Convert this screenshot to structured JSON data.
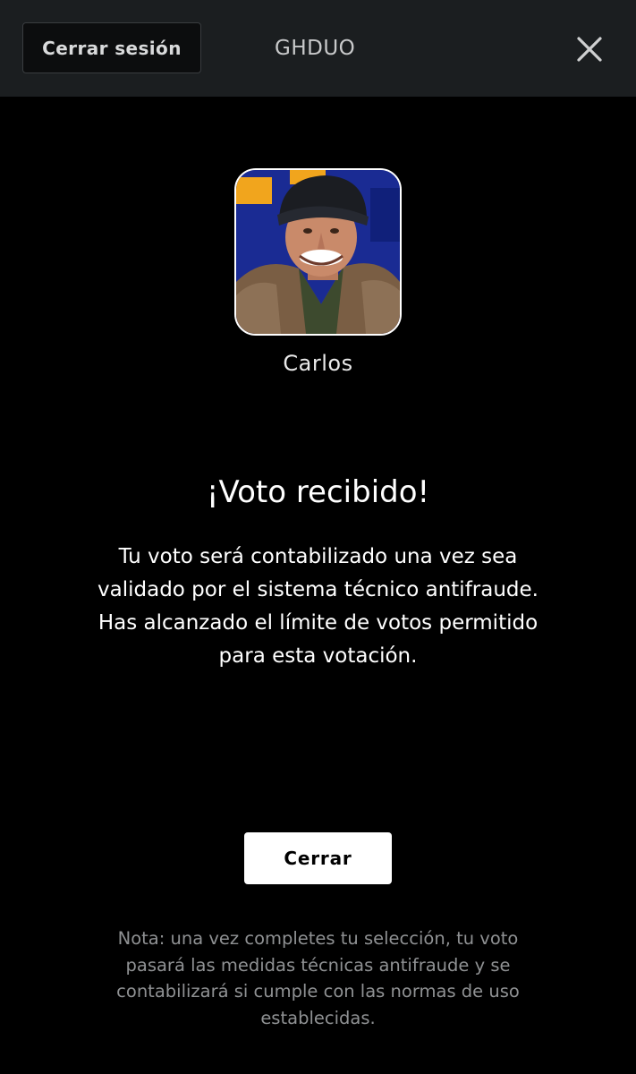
{
  "header": {
    "logout_label": "Cerrar sesión",
    "title": "GHDUO",
    "close_icon": "close-icon"
  },
  "candidate": {
    "name": "Carlos",
    "avatar_icon": "candidate-photo"
  },
  "result": {
    "title": "¡Voto recibido!",
    "message_lines": [
      "Tu voto será contabilizado una vez sea",
      "validado por el sistema técnico antifraude.",
      "Has alcanzado el límite de votos permitido",
      "para esta votación."
    ]
  },
  "actions": {
    "close_label": "Cerrar"
  },
  "footer": {
    "note_lines": [
      "Nota: una vez completes tu selección, tu voto",
      "pasará las medidas técnicas antifraude y se",
      "contabilizará si cumple con las normas de uso",
      "establecidas."
    ]
  },
  "colors": {
    "background": "#000000",
    "header_background": "#1b1e20",
    "button_primary": "#ffffff",
    "note_text": "#8f9193"
  }
}
